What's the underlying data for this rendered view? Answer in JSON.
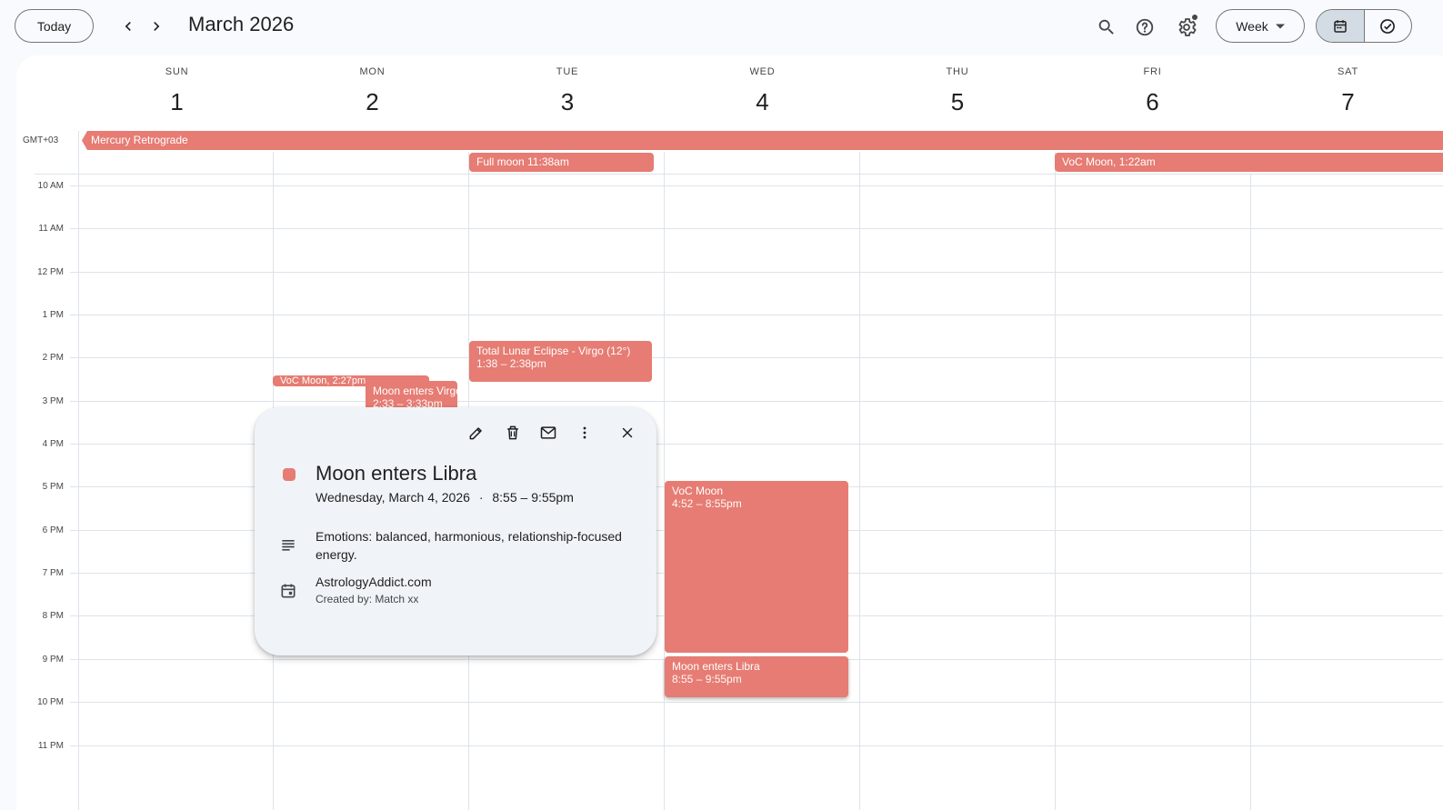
{
  "header": {
    "today_label": "Today",
    "month_title": "March 2026",
    "view_select": "Week",
    "icons": [
      "chevron-left-icon",
      "chevron-right-icon",
      "search-icon",
      "help-icon",
      "settings-icon",
      "dropdown-arrow-icon",
      "calendar-view-icon",
      "tasks-view-icon"
    ]
  },
  "timezone": "GMT+03",
  "days": [
    {
      "name": "SUN",
      "num": "1"
    },
    {
      "name": "MON",
      "num": "2"
    },
    {
      "name": "TUE",
      "num": "3"
    },
    {
      "name": "WED",
      "num": "4"
    },
    {
      "name": "THU",
      "num": "5"
    },
    {
      "name": "FRI",
      "num": "6"
    },
    {
      "name": "SAT",
      "num": "7"
    }
  ],
  "hours": [
    "10 AM",
    "11 AM",
    "12 PM",
    "1 PM",
    "2 PM",
    "3 PM",
    "4 PM",
    "5 PM",
    "6 PM",
    "7 PM",
    "8 PM",
    "9 PM",
    "10 PM",
    "11 PM"
  ],
  "allday": {
    "retrograde": "Mercury Retrograde",
    "full_moon": "Full moon 11:38am",
    "voc_fri": "VoC Moon, 1:22am"
  },
  "events": {
    "eclipse_title": "Total Lunar Eclipse - Virgo (12°)",
    "eclipse_time": "1:38 – 2:38pm",
    "voc_mon": "VoC Moon, 2:27pm",
    "virgo_title": "Moon enters Virgo",
    "virgo_time": "2:33 – 3:33pm",
    "voc_wed_title": "VoC Moon",
    "voc_wed_time": "4:52 – 8:55pm",
    "libra_title": "Moon enters Libra",
    "libra_time": "8:55 – 9:55pm"
  },
  "event_color": "#e67c73",
  "popup": {
    "title": "Moon enters Libra",
    "date": "Wednesday, March 4, 2026",
    "separator": "·",
    "time": "8:55 – 9:55pm",
    "description": "Emotions: balanced, harmonious, relationship-focused energy.",
    "calendar": "AstrologyAddict.com",
    "creator": "Created by: Match xx",
    "icons": [
      "edit-icon",
      "delete-icon",
      "email-icon",
      "more-options-icon",
      "close-icon",
      "description-icon",
      "calendar-icon"
    ]
  }
}
